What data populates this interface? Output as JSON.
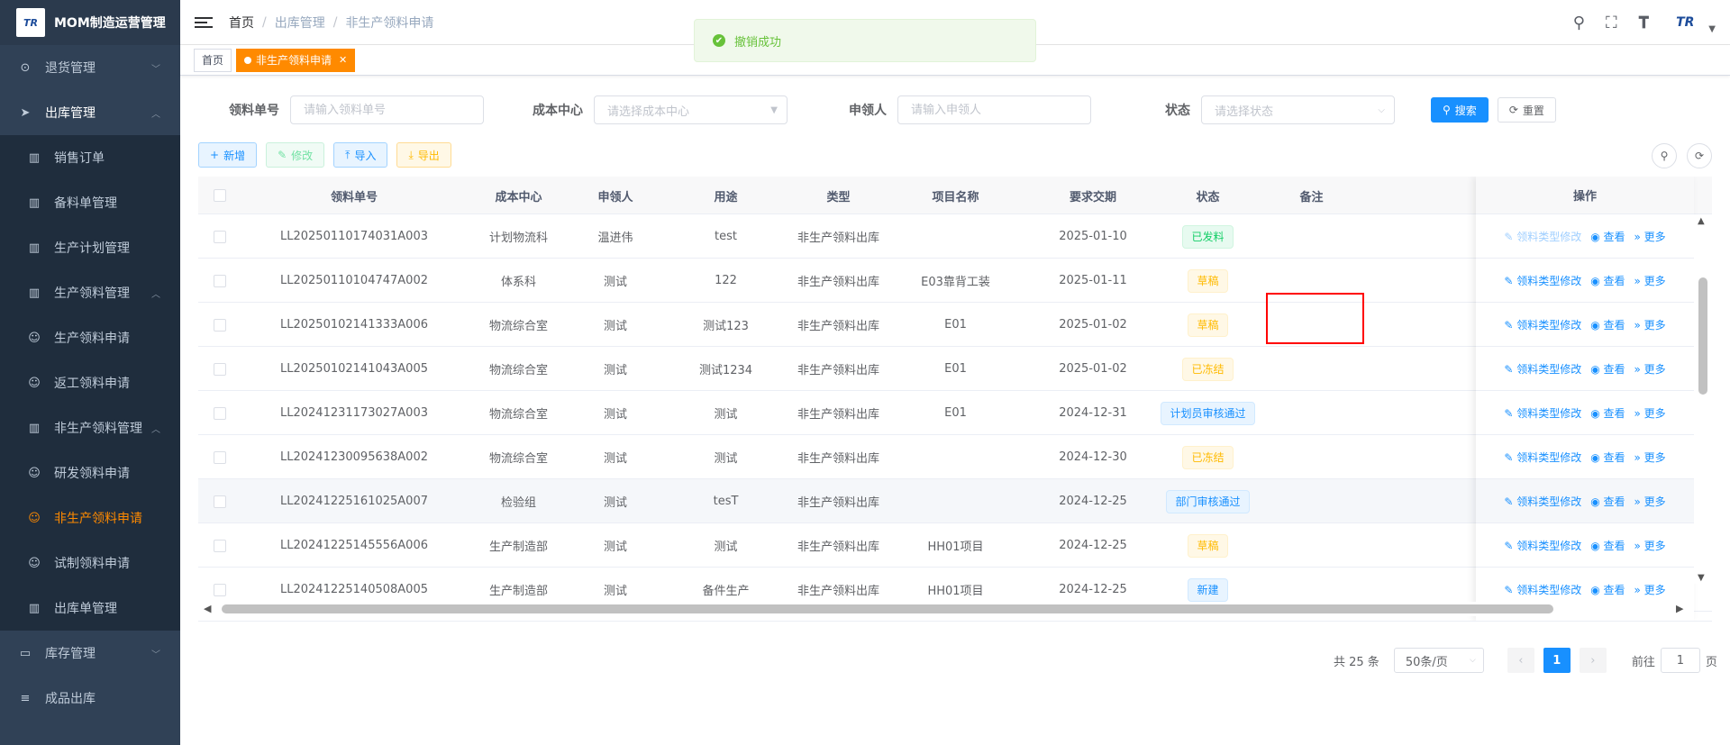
{
  "app": {
    "logo_text": "TR",
    "title": "MOM制造运营管理"
  },
  "sidebar": {
    "items": [
      {
        "label": "退货管理",
        "icon": "return-icon",
        "glyph": "⊙",
        "level": "top",
        "arrow": "﹀"
      },
      {
        "label": "出库管理",
        "icon": "send-icon",
        "glyph": "➤",
        "level": "open",
        "arrow": "︿"
      },
      {
        "label": "销售订单",
        "icon": "book-icon",
        "glyph": "▥",
        "level": "sub"
      },
      {
        "label": "备料单管理",
        "icon": "book-icon",
        "glyph": "▥",
        "level": "sub"
      },
      {
        "label": "生产计划管理",
        "icon": "book-icon",
        "glyph": "▥",
        "level": "sub"
      },
      {
        "label": "生产领料管理",
        "icon": "book-icon",
        "glyph": "▥",
        "level": "sub",
        "arrow": "︿"
      },
      {
        "label": "生产领料申请",
        "icon": "bot-icon",
        "glyph": "☺",
        "level": "sub2"
      },
      {
        "label": "返工领料申请",
        "icon": "bot-icon",
        "glyph": "☺",
        "level": "sub2"
      },
      {
        "label": "非生产领料管理",
        "icon": "book-icon",
        "glyph": "▥",
        "level": "sub",
        "arrow": "︿"
      },
      {
        "label": "研发领料申请",
        "icon": "bot-icon",
        "glyph": "☺",
        "level": "sub2"
      },
      {
        "label": "非生产领料申请",
        "icon": "bot-icon",
        "glyph": "☺",
        "level": "sub2",
        "active": true
      },
      {
        "label": "试制领料申请",
        "icon": "bot-icon",
        "glyph": "☺",
        "level": "sub2"
      },
      {
        "label": "出库单管理",
        "icon": "book-icon",
        "glyph": "▥",
        "level": "sub"
      },
      {
        "label": "库存管理",
        "icon": "monitor-icon",
        "glyph": "▭",
        "level": "top",
        "arrow": "﹀"
      },
      {
        "label": "成品出库",
        "icon": "list-icon",
        "glyph": "≡",
        "level": "top"
      }
    ]
  },
  "header": {
    "breadcrumb": [
      "首页",
      "出库管理",
      "非生产领料申请"
    ],
    "avatar_text": "TR"
  },
  "tags": {
    "home": "首页",
    "active": "非生产领料申请"
  },
  "toast": {
    "message": "撤销成功"
  },
  "search": {
    "code_label": "领料单号",
    "code_placeholder": "请输入领料单号",
    "cost_label": "成本中心",
    "cost_placeholder": "请选择成本中心",
    "applicant_label": "申领人",
    "applicant_placeholder": "请输入申领人",
    "status_label": "状态",
    "status_placeholder": "请选择状态",
    "search_btn": "搜索",
    "reset_btn": "重置"
  },
  "toolbar": {
    "add": "新增",
    "edit": "修改",
    "import": "导入",
    "export": "导出"
  },
  "table": {
    "columns": [
      "领料单号",
      "成本中心",
      "申领人",
      "用途",
      "类型",
      "项目名称",
      "要求交期",
      "状态",
      "备注",
      "操作"
    ],
    "ops": {
      "type_edit": "领料类型修改",
      "view": "查看",
      "more": "更多"
    },
    "rows": [
      {
        "code": "LL20250110174031A003",
        "cost": "计划物流科",
        "applicant": "温进伟",
        "purpose": "test",
        "type": "非生产领料出库",
        "project": "",
        "date": "2025-01-10",
        "status": "已发料",
        "status_kind": "success",
        "op_disabled": true
      },
      {
        "code": "LL20250110104747A002",
        "cost": "体系科",
        "applicant": "测试",
        "purpose": "122",
        "type": "非生产领料出库",
        "project": "E03靠背工装",
        "date": "2025-01-11",
        "status": "草稿",
        "status_kind": "warning"
      },
      {
        "code": "LL20250102141333A006",
        "cost": "物流综合室",
        "applicant": "测试",
        "purpose": "测试123",
        "type": "非生产领料出库",
        "project": "E01",
        "date": "2025-01-02",
        "status": "草稿",
        "status_kind": "warning"
      },
      {
        "code": "LL20250102141043A005",
        "cost": "物流综合室",
        "applicant": "测试",
        "purpose": "测试1234",
        "type": "非生产领料出库",
        "project": "E01",
        "date": "2025-01-02",
        "status": "已冻结",
        "status_kind": "warning"
      },
      {
        "code": "LL20241231173027A003",
        "cost": "物流综合室",
        "applicant": "测试",
        "purpose": "测试",
        "type": "非生产领料出库",
        "project": "E01",
        "date": "2024-12-31",
        "status": "计划员审核通过",
        "status_kind": "primary"
      },
      {
        "code": "LL20241230095638A002",
        "cost": "物流综合室",
        "applicant": "测试",
        "purpose": "测试",
        "type": "非生产领料出库",
        "project": "",
        "date": "2024-12-30",
        "status": "已冻结",
        "status_kind": "warning"
      },
      {
        "code": "LL20241225161025A007",
        "cost": "检验组",
        "applicant": "测试",
        "purpose": "tesT",
        "type": "非生产领料出库",
        "project": "",
        "date": "2024-12-25",
        "status": "部门审核通过",
        "status_kind": "primary",
        "hover": true
      },
      {
        "code": "LL20241225145556A006",
        "cost": "生产制造部",
        "applicant": "测试",
        "purpose": "测试",
        "type": "非生产领料出库",
        "project": "HH01项目",
        "date": "2024-12-25",
        "status": "草稿",
        "status_kind": "warning"
      },
      {
        "code": "LL20241225140508A005",
        "cost": "生产制造部",
        "applicant": "测试",
        "purpose": "备件生产",
        "type": "非生产领料出库",
        "project": "HH01项目",
        "date": "2024-12-25",
        "status": "新建",
        "status_kind": "primary"
      }
    ]
  },
  "pagination": {
    "total": "共 25 条",
    "page_size": "50条/页",
    "current": "1",
    "goto_prefix": "前往",
    "goto_value": "1",
    "goto_suffix": "页"
  }
}
